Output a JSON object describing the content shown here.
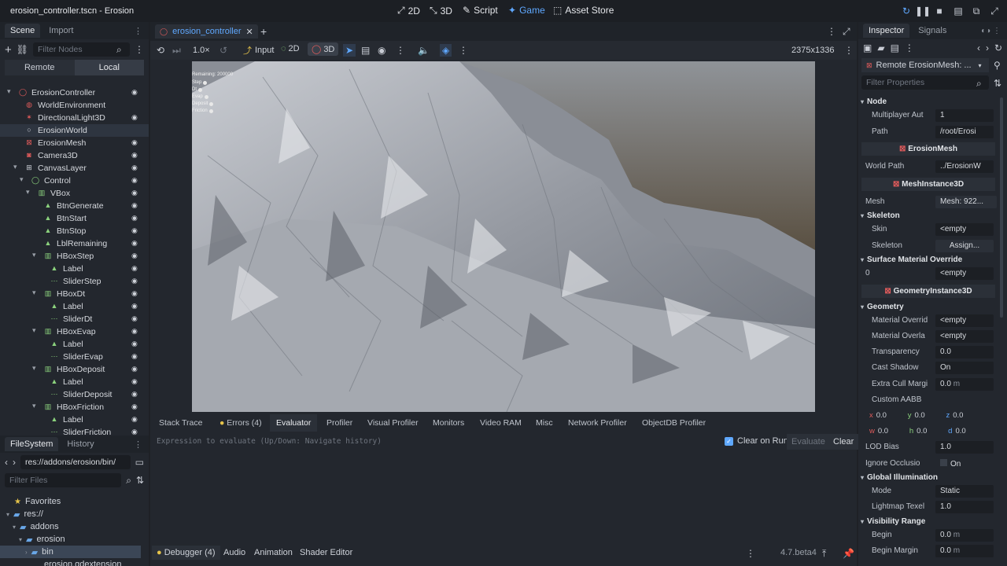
{
  "window": {
    "title": "erosion_controller.tscn - Erosion",
    "workspaces": [
      {
        "label": "2D",
        "icon": "2d-icon"
      },
      {
        "label": "3D",
        "icon": "3d-icon"
      },
      {
        "label": "Script",
        "icon": "script-icon"
      },
      {
        "label": "Game",
        "icon": "game-icon"
      },
      {
        "label": "Asset Store",
        "icon": "asset-store-icon"
      }
    ]
  },
  "scene_dock": {
    "tabs": [
      "Scene",
      "Import"
    ],
    "filter_placeholder": "Filter Nodes",
    "remote_label": "Remote",
    "local_label": "Local",
    "tree": [
      {
        "label": "ErosionController",
        "depth": 0,
        "icon": "node3d-icon",
        "color": "#e05b5b"
      },
      {
        "label": "WorldEnvironment",
        "depth": 1,
        "icon": "world-environment-icon",
        "color": "#e05b5b"
      },
      {
        "label": "DirectionalLight3D",
        "depth": 1,
        "icon": "light-icon",
        "color": "#e05b5b"
      },
      {
        "label": "ErosionWorld",
        "depth": 1,
        "icon": "node-icon",
        "color": "#cfd3da"
      },
      {
        "label": "ErosionMesh",
        "depth": 1,
        "icon": "mesh-icon",
        "color": "#e05b5b"
      },
      {
        "label": "Camera3D",
        "depth": 1,
        "icon": "camera-icon",
        "color": "#e05b5b"
      },
      {
        "label": "CanvasLayer",
        "depth": 1,
        "icon": "canvas-layer-icon",
        "color": "#cfd3da"
      },
      {
        "label": "Control",
        "depth": 2,
        "icon": "control-icon",
        "color": "#8bd27d"
      },
      {
        "label": "VBox",
        "depth": 3,
        "icon": "vbox-icon",
        "color": "#8bd27d"
      },
      {
        "label": "BtnGenerate",
        "depth": 4,
        "icon": "button-icon",
        "color": "#8bd27d"
      },
      {
        "label": "BtnStart",
        "depth": 4,
        "icon": "button-icon",
        "color": "#8bd27d"
      },
      {
        "label": "BtnStop",
        "depth": 4,
        "icon": "button-icon",
        "color": "#8bd27d"
      },
      {
        "label": "LblRemaining",
        "depth": 4,
        "icon": "label-icon",
        "color": "#8bd27d"
      },
      {
        "label": "HBoxStep",
        "depth": 4,
        "icon": "hbox-icon",
        "color": "#8bd27d"
      },
      {
        "label": "Label",
        "depth": 5,
        "icon": "label-icon",
        "color": "#8bd27d"
      },
      {
        "label": "SliderStep",
        "depth": 5,
        "icon": "slider-icon",
        "color": "#8bd27d"
      },
      {
        "label": "HBoxDt",
        "depth": 4,
        "icon": "hbox-icon",
        "color": "#8bd27d"
      },
      {
        "label": "Label",
        "depth": 5,
        "icon": "label-icon",
        "color": "#8bd27d"
      },
      {
        "label": "SliderDt",
        "depth": 5,
        "icon": "slider-icon",
        "color": "#8bd27d"
      },
      {
        "label": "HBoxEvap",
        "depth": 4,
        "icon": "hbox-icon",
        "color": "#8bd27d"
      },
      {
        "label": "Label",
        "depth": 5,
        "icon": "label-icon",
        "color": "#8bd27d"
      },
      {
        "label": "SliderEvap",
        "depth": 5,
        "icon": "slider-icon",
        "color": "#8bd27d"
      },
      {
        "label": "HBoxDeposit",
        "depth": 4,
        "icon": "hbox-icon",
        "color": "#8bd27d"
      },
      {
        "label": "Label",
        "depth": 5,
        "icon": "label-icon",
        "color": "#8bd27d"
      },
      {
        "label": "SliderDeposit",
        "depth": 5,
        "icon": "slider-icon",
        "color": "#8bd27d"
      },
      {
        "label": "HBoxFriction",
        "depth": 4,
        "icon": "hbox-icon",
        "color": "#8bd27d"
      },
      {
        "label": "Label",
        "depth": 5,
        "icon": "label-icon",
        "color": "#8bd27d"
      },
      {
        "label": "SliderFriction",
        "depth": 5,
        "icon": "slider-icon",
        "color": "#8bd27d"
      }
    ]
  },
  "filesystem": {
    "tabs": [
      "FileSystem",
      "History"
    ],
    "path": "res://addons/erosion/bin/",
    "filter_placeholder": "Filter Files",
    "items": [
      {
        "label": "Favorites",
        "depth": 0
      },
      {
        "label": "res://",
        "depth": 0
      },
      {
        "label": "addons",
        "depth": 1
      },
      {
        "label": "erosion",
        "depth": 2
      },
      {
        "label": "bin",
        "depth": 3
      },
      {
        "label": "erosion.gdextension",
        "depth": 3
      }
    ]
  },
  "editor": {
    "scene_tab": "erosion_controller",
    "zoom": "1.0×",
    "input_label": "Input",
    "mode_2d": "2D",
    "mode_3d": "3D",
    "resolution": "2375x1336",
    "overlay": {
      "remaining": "Remaining: 200000",
      "sliders": [
        "Step",
        "Dt",
        "Evap",
        "Deposit",
        "Friction"
      ]
    }
  },
  "bottom_panel": {
    "tabs": [
      "Stack Trace",
      "Errors (4)",
      "Evaluator",
      "Profiler",
      "Visual Profiler",
      "Monitors",
      "Video RAM",
      "Misc",
      "Network Profiler",
      "ObjectDB Profiler"
    ],
    "expression_placeholder": "Expression to evaluate (Up/Down: Navigate history)",
    "clear_on_run": "Clear on Run",
    "evaluate": "Evaluate",
    "clear": "Clear",
    "dock_tabs": [
      "Debugger (4)",
      "Audio",
      "Animation",
      "Shader Editor"
    ],
    "version": "4.7.beta4"
  },
  "inspector": {
    "tabs": [
      "Inspector",
      "Signals"
    ],
    "object": "Remote ErosionMesh: ...",
    "filter_placeholder": "Filter Properties",
    "node_section": "Node",
    "multiplayer_label": "Multiplayer Aut",
    "multiplayer_value": "1",
    "path_label": "Path",
    "path_value": "/root/Erosi",
    "class_erosion": "ErosionMesh",
    "world_path_label": "World Path",
    "world_path_value": "../ErosionW",
    "class_mesh": "MeshInstance3D",
    "mesh_label": "Mesh",
    "mesh_value": "Mesh: 922...",
    "skeleton_section": "Skeleton",
    "skin_label": "Skin",
    "skin_value": "<empty",
    "skeleton_label": "Skeleton",
    "skeleton_value": "Assign...",
    "surface_section": "Surface Material Override",
    "surface_index": "0",
    "surface_value": "<empty",
    "class_geometry": "GeometryInstance3D",
    "geometry_section": "Geometry",
    "material_override_label": "Material Overrid",
    "material_override_value": "<empty",
    "material_overlay_label": "Material Overla",
    "material_overlay_value": "<empty",
    "transparency_label": "Transparency",
    "transparency_value": "0.0",
    "cast_shadow_label": "Cast Shadow",
    "cast_shadow_value": "On",
    "cull_margin_label": "Extra Cull Margi",
    "cull_margin_value": "0.0",
    "cull_unit": "m",
    "aabb_label": "Custom AABB",
    "aabb": {
      "x": "0.0",
      "y": "0.0",
      "z": "0.0",
      "w": "0.0",
      "h": "0.0",
      "d": "0.0"
    },
    "lod_label": "LOD Bias",
    "lod_value": "1.0",
    "ignore_label": "Ignore Occlusio",
    "ignore_value": "On",
    "gi_section": "Global Illumination",
    "mode_label": "Mode",
    "mode_value": "Static",
    "lightmap_label": "Lightmap Texel",
    "lightmap_value": "1.0",
    "visibility_section": "Visibility Range",
    "begin_label": "Begin",
    "begin_value": "0.0",
    "begin_margin_label": "Begin Margin",
    "begin_margin_value": "0.0"
  }
}
